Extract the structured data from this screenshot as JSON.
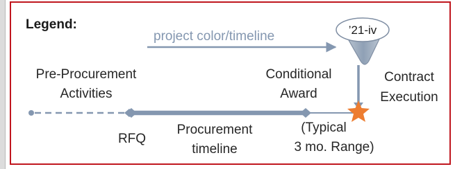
{
  "legend": {
    "title": "Legend:",
    "arrow_label": "project color/timeline",
    "marker_label": "’21-iv"
  },
  "phases": {
    "pre_procurement": [
      "Pre-Procurement",
      "Activities"
    ],
    "conditional_award": [
      "Conditional",
      "Award"
    ],
    "contract_execution": [
      "Contract",
      "Execution"
    ],
    "rfq": "RFQ",
    "procurement_timeline": [
      "Procurement",
      "timeline"
    ],
    "typical_range": [
      "(Typical",
      "3 mo. Range)"
    ]
  },
  "colors": {
    "border": "#c0161e",
    "timeline": "#8497b0",
    "marker_fill": "#a7b4c4",
    "star": "#ed7d31",
    "text": "#262626",
    "legend_text": "#8497b0"
  }
}
